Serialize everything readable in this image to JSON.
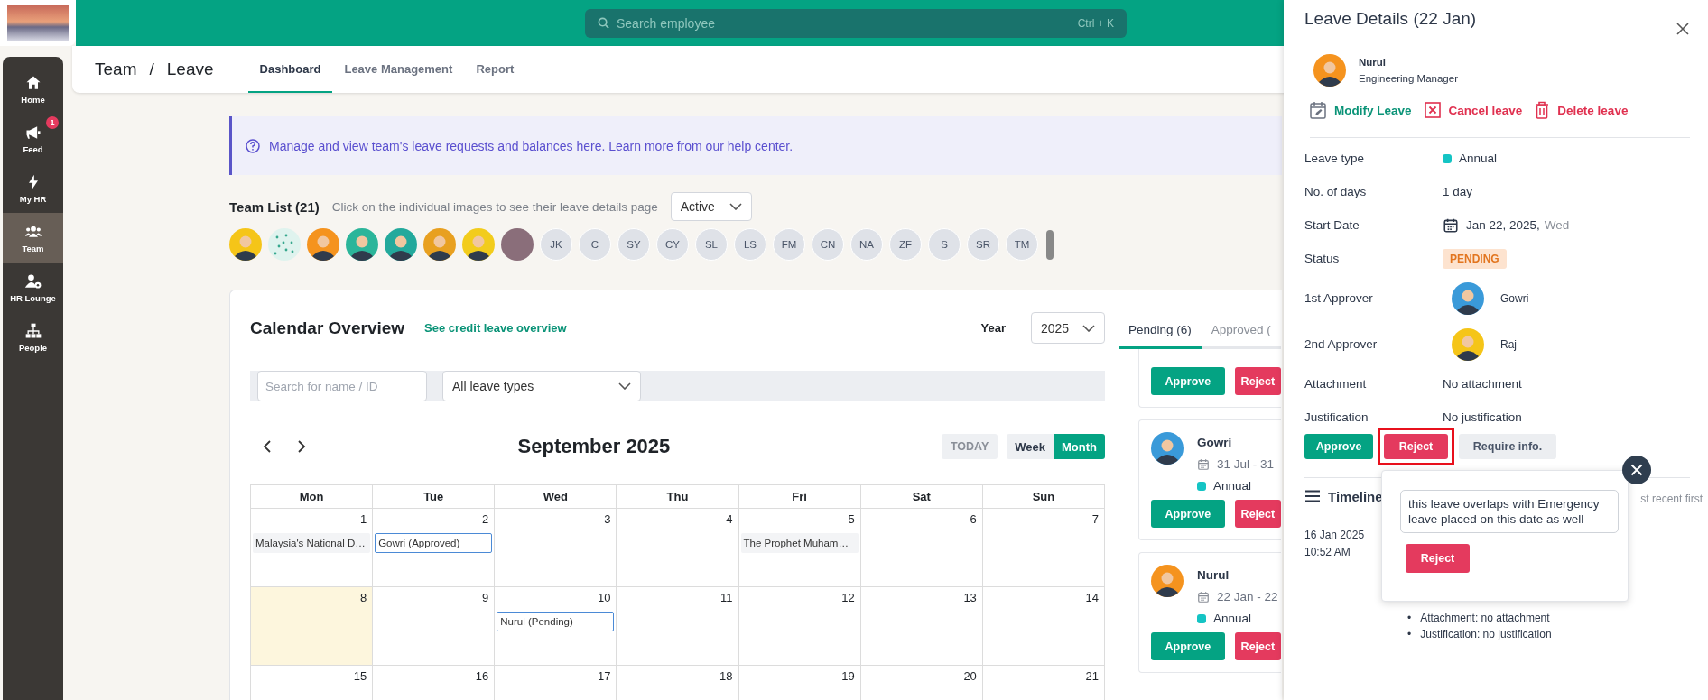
{
  "top_bar": {
    "search": {
      "placeholder": "Search employee",
      "shortcut": "Ctrl + K"
    }
  },
  "sidebar": {
    "items": [
      {
        "label": "Home",
        "selected": false
      },
      {
        "label": "Feed",
        "badge": "1",
        "selected": false
      },
      {
        "label": "My HR",
        "selected": false
      },
      {
        "label": "Team",
        "selected": true
      },
      {
        "label": "HR Lounge",
        "selected": false
      },
      {
        "label": "People",
        "selected": false
      }
    ]
  },
  "header": {
    "breadcrumb": [
      "Team",
      "Leave"
    ],
    "separator": "/",
    "tabs": [
      {
        "label": "Dashboard",
        "selected": true
      },
      {
        "label": "Leave Management",
        "selected": false
      },
      {
        "label": "Report",
        "selected": false
      }
    ]
  },
  "banner": {
    "text": "Manage and view team's leave requests and balances here. Learn more from our help center."
  },
  "team_list": {
    "title": "Team List (21)",
    "hint": "Click on the individual images to see their leave details page",
    "filter": "Active",
    "members": [
      {
        "kind": "illustration"
      },
      {
        "kind": "pattern"
      },
      {
        "kind": "illustration"
      },
      {
        "kind": "illustration"
      },
      {
        "kind": "illustration"
      },
      {
        "kind": "illustration"
      },
      {
        "kind": "illustration"
      },
      {
        "kind": "photo"
      },
      {
        "kind": "initials",
        "initials": "JK"
      },
      {
        "kind": "initials",
        "initials": "C"
      },
      {
        "kind": "initials",
        "initials": "SY"
      },
      {
        "kind": "initials",
        "initials": "CY"
      },
      {
        "kind": "initials",
        "initials": "SL"
      },
      {
        "kind": "initials",
        "initials": "LS"
      },
      {
        "kind": "initials",
        "initials": "FM"
      },
      {
        "kind": "initials",
        "initials": "CN"
      },
      {
        "kind": "initials",
        "initials": "NA"
      },
      {
        "kind": "initials",
        "initials": "ZF"
      },
      {
        "kind": "initials",
        "initials": "S"
      },
      {
        "kind": "initials",
        "initials": "SR"
      },
      {
        "kind": "initials",
        "initials": "TM"
      }
    ]
  },
  "calendar": {
    "title": "Calendar Overview",
    "link": "See credit leave overview",
    "year_label": "Year",
    "year": "2025",
    "search_placeholder": "Search for name / ID",
    "leave_type": "All leave types",
    "month": "September 2025",
    "today_button": "TODAY",
    "views": [
      {
        "label": "Week",
        "selected": false
      },
      {
        "label": "Month",
        "selected": true
      }
    ],
    "weekdays": [
      "Mon",
      "Tue",
      "Wed",
      "Thu",
      "Fri",
      "Sat",
      "Sun"
    ],
    "weeks": [
      [
        {
          "day": "1",
          "today": false,
          "events": [
            {
              "kind": "holiday",
              "label": "Malaysia's National D…"
            }
          ]
        },
        {
          "day": "2",
          "today": false,
          "events": [
            {
              "kind": "leave",
              "label": "Gowri (Approved)"
            }
          ]
        },
        {
          "day": "3",
          "today": false
        },
        {
          "day": "4",
          "today": false
        },
        {
          "day": "5",
          "today": false,
          "events": [
            {
              "kind": "holiday",
              "label": "The Prophet Muham…"
            }
          ]
        },
        {
          "day": "6",
          "today": false
        },
        {
          "day": "7",
          "today": false
        }
      ],
      [
        {
          "day": "8",
          "today": true
        },
        {
          "day": "9",
          "today": false
        },
        {
          "day": "10",
          "today": false,
          "events": [
            {
              "kind": "leave",
              "label": "Nurul (Pending)"
            }
          ]
        },
        {
          "day": "11",
          "today": false
        },
        {
          "day": "12",
          "today": false
        },
        {
          "day": "13",
          "today": false
        },
        {
          "day": "14",
          "today": false
        }
      ],
      [
        {
          "day": "15",
          "today": false
        },
        {
          "day": "16",
          "today": false
        },
        {
          "day": "17",
          "today": false
        },
        {
          "day": "18",
          "today": false
        },
        {
          "day": "19",
          "today": false
        },
        {
          "day": "20",
          "today": false
        },
        {
          "day": "21",
          "today": false
        }
      ]
    ]
  },
  "requests": {
    "tabs": [
      {
        "label": "Pending (6)",
        "selected": true
      },
      {
        "label": "Approved (",
        "selected": false
      }
    ],
    "cards": [
      {
        "kind": "partial",
        "approve": "Approve",
        "reject": "Reject"
      },
      {
        "kind": "full",
        "name": "Gowri",
        "dates": "31 Jul - 31",
        "leave_type": "Annual",
        "color": "#14c4c4",
        "approve": "Approve",
        "reject": "Reject"
      },
      {
        "kind": "full",
        "name": "Nurul",
        "dates": "22 Jan - 22",
        "leave_type": "Annual",
        "color": "#14c4c4",
        "approve": "Approve",
        "reject": "Reject"
      }
    ]
  },
  "details": {
    "title": "Leave Details (22 Jan)",
    "person": {
      "name": "Nurul",
      "role": "Engineering Manager"
    },
    "actions": [
      {
        "kind": "modify",
        "label": "Modify Leave"
      },
      {
        "kind": "cancel",
        "label": "Cancel leave"
      },
      {
        "kind": "delete",
        "label": "Delete leave"
      }
    ],
    "fields": [
      {
        "kind": "type",
        "label": "Leave type",
        "value": "Annual",
        "color": "#14c4c4"
      },
      {
        "kind": "text",
        "label": "No. of days",
        "value": "1 day"
      },
      {
        "kind": "date",
        "label": "Start Date",
        "value": "Jan 22, 2025,",
        "weekday": "Wed"
      },
      {
        "kind": "status",
        "label": "Status",
        "value": "PENDING"
      },
      {
        "kind": "approver",
        "label": "1st Approver",
        "value": "Gowri"
      },
      {
        "kind": "approver",
        "label": "2nd Approver",
        "value": "Raj"
      },
      {
        "kind": "text",
        "label": "Attachment",
        "value": "No attachment"
      },
      {
        "kind": "text",
        "label": "Justification",
        "value": "No justification"
      }
    ],
    "buttons": [
      {
        "kind": "approve",
        "label": "Approve",
        "highlighted": false
      },
      {
        "kind": "reject",
        "label": "Reject",
        "highlighted": true
      },
      {
        "kind": "info",
        "label": "Require info.",
        "highlighted": false
      }
    ],
    "timeline": {
      "title": "Timeline",
      "order": "st recent first",
      "entries": [
        {
          "date": "16 Jan 2025",
          "time": "10:52 AM",
          "bullet": "•",
          "notes": [
            "Attachment: no attachment",
            "Justification: no justification"
          ]
        }
      ]
    },
    "reject_popover": {
      "reason": "this leave overlaps with Emergency leave placed on this date as well",
      "button": "Reject"
    }
  }
}
